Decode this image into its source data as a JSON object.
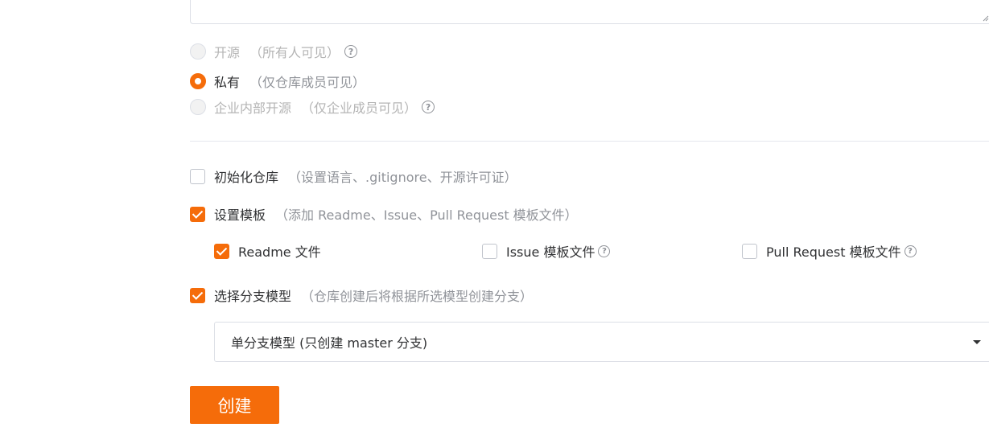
{
  "visibility": {
    "options": [
      {
        "label": "开源",
        "hint": "（所有人可见）",
        "state": "disabled",
        "help": "?"
      },
      {
        "label": "私有",
        "hint": "（仅仓库成员可见）",
        "state": "checked"
      },
      {
        "label": "企业内部开源",
        "hint": "（仅企业成员可见）",
        "state": "disabled",
        "help": "?"
      }
    ]
  },
  "init_repo": {
    "label": "初始化仓库",
    "hint": "（设置语言、.gitignore、开源许可证）",
    "checked": false
  },
  "templates": {
    "label": "设置模板",
    "hint": "（添加 Readme、Issue、Pull Request 模板文件）",
    "checked": true,
    "items": [
      {
        "label": "Readme 文件",
        "checked": true
      },
      {
        "label": "Issue 模板文件",
        "checked": false,
        "help": "?"
      },
      {
        "label": "Pull Request 模板文件",
        "checked": false,
        "help": "?"
      }
    ]
  },
  "branch_model": {
    "label": "选择分支模型",
    "hint": "（仓库创建后将根据所选模型创建分支）",
    "checked": true,
    "selected": "单分支模型 (只创建 master 分支)"
  },
  "create_button": {
    "label": "创建"
  },
  "colors": {
    "accent": "#f56c0a",
    "border": "#dcdfe6",
    "muted": "#909399"
  }
}
